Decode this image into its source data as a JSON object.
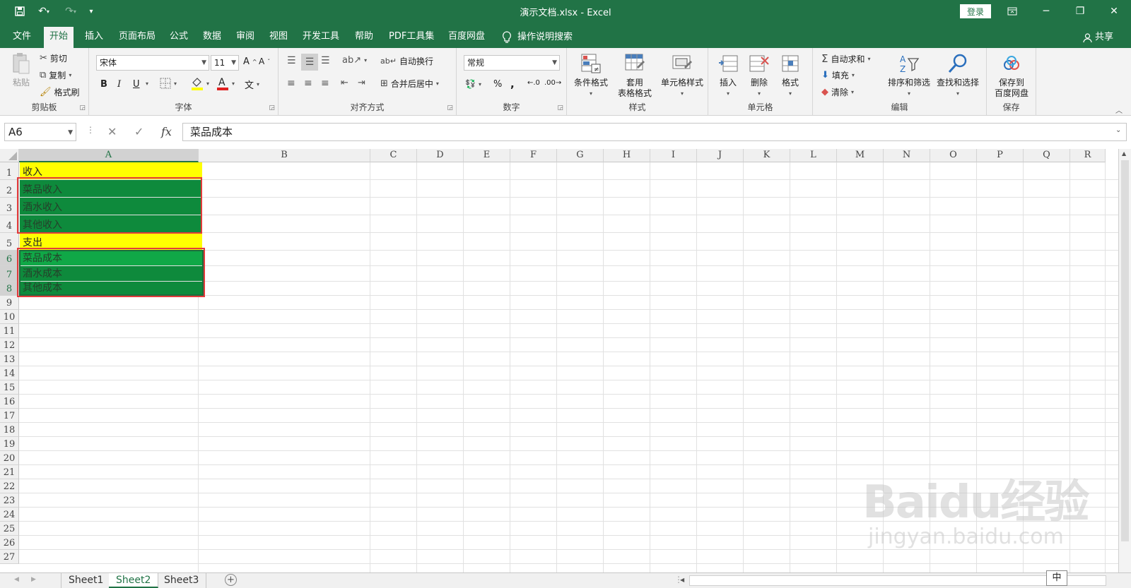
{
  "window": {
    "title": "演示文档.xlsx  -  Excel",
    "login": "登录"
  },
  "tabs": [
    "文件",
    "开始",
    "插入",
    "页面布局",
    "公式",
    "数据",
    "审阅",
    "视图",
    "开发工具",
    "帮助",
    "PDF工具集",
    "百度网盘"
  ],
  "active_tab": "开始",
  "tell_me": "操作说明搜索",
  "share": "共享",
  "ribbon": {
    "clipboard": {
      "label": "剪贴板",
      "paste": "粘贴",
      "cut": "剪切",
      "copy": "复制",
      "format_painter": "格式刷"
    },
    "font": {
      "label": "字体",
      "name": "宋体",
      "size": "11",
      "bold": "B",
      "italic": "I",
      "underline": "U",
      "wen": "文"
    },
    "alignment": {
      "label": "对齐方式",
      "wrap": "自动换行",
      "merge": "合并后居中"
    },
    "number": {
      "label": "数字",
      "format": "常规",
      "percent": "%",
      "comma": ","
    },
    "styles": {
      "label": "样式",
      "conditional": "条件格式",
      "table_line1": "套用",
      "table_line2": "表格格式",
      "cell_styles": "单元格样式"
    },
    "cells": {
      "label": "单元格",
      "insert": "插入",
      "delete": "删除",
      "format": "格式"
    },
    "editing": {
      "label": "编辑",
      "autosum": "自动求和",
      "fill": "填充",
      "clear": "清除",
      "sort": "排序和筛选",
      "find": "查找和选择"
    },
    "save": {
      "label": "保存",
      "line1": "保存到",
      "line2": "百度网盘"
    }
  },
  "formula_bar": {
    "name_box": "A6",
    "fx": "fx",
    "value": "菜品成本"
  },
  "columns": [
    "A",
    "B",
    "C",
    "D",
    "E",
    "F",
    "G",
    "H",
    "I",
    "J",
    "K",
    "L",
    "M",
    "N",
    "O",
    "P",
    "Q",
    "R"
  ],
  "rows": [
    "1",
    "2",
    "3",
    "4",
    "5",
    "6",
    "7",
    "8",
    "9",
    "10",
    "11",
    "12",
    "13",
    "14",
    "15",
    "16",
    "17",
    "18",
    "19",
    "20",
    "21",
    "22",
    "23",
    "24",
    "25",
    "26",
    "27"
  ],
  "cells": {
    "A1": "收入",
    "A2": "菜品收入",
    "A3": "酒水收入",
    "A4": "其他收入",
    "A5": "支出",
    "A6": "菜品成本",
    "A7": "酒水成本",
    "A8": "其他成本"
  },
  "colors": {
    "excel_green": "#217346",
    "yellow_fill": "#ffff00",
    "green_fill": "#0e8a3c",
    "highlight_box": "#e23b3b"
  },
  "sheets": [
    "Sheet1",
    "Sheet2",
    "Sheet3"
  ],
  "active_sheet": "Sheet2",
  "watermark": {
    "main": "Baidu经验",
    "sub": "jingyan.baidu.com"
  },
  "ime": "中"
}
